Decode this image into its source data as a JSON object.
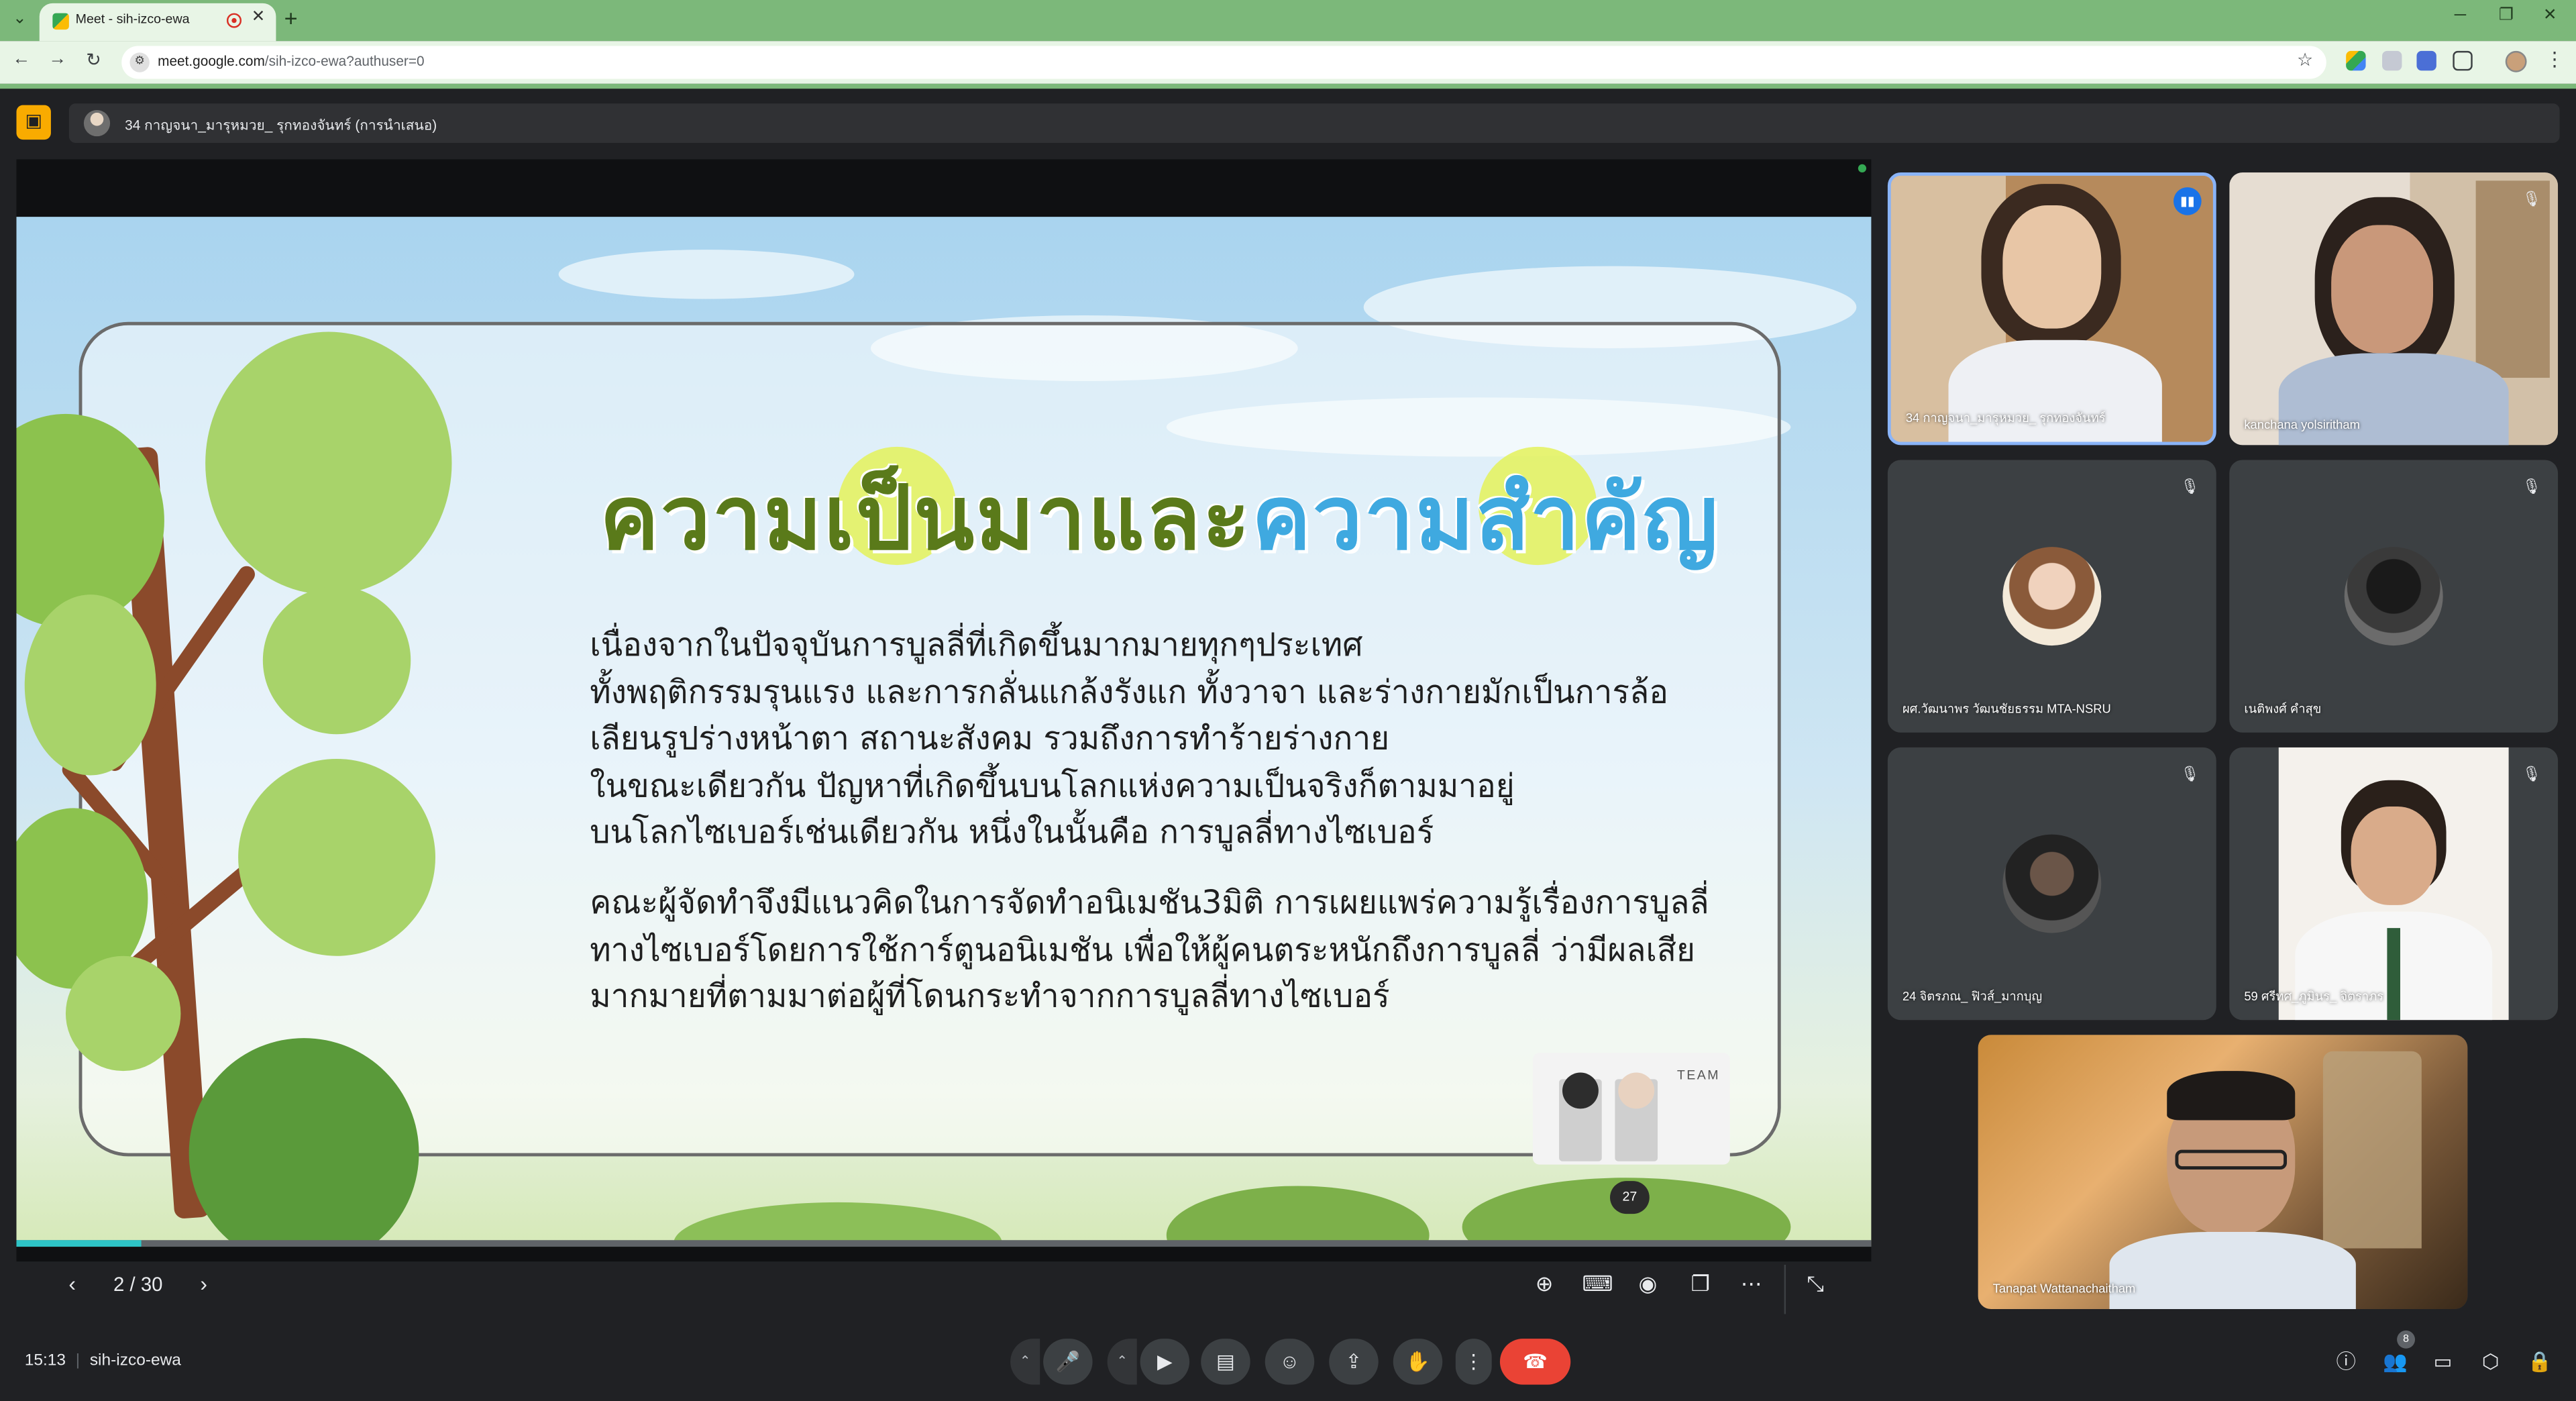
{
  "browser": {
    "tab_title": "Meet - sih-izco-ewa",
    "url_host": "meet.google.com",
    "url_path": "/sih-izco-ewa?authuser=0"
  },
  "meet": {
    "presenter_label": "34 กาญจนา_มารุหมวย_ รุกทองจันทร์ (การนำเสนอ)",
    "slide": {
      "title_part1": "ความเป็นมาและ",
      "title_part2": "ความสำคัญ",
      "paragraph1": [
        "เนื่องจากในปัจจุบันการบูลลี่ที่เกิดขึ้นมากมายทุกๆประเทศ",
        "ทั้งพฤติกรรมรุนแรง และการกลั่นแกล้งรังแก ทั้งวาจา และร่างกายมักเป็นการล้อ",
        "เลียนรูปร่างหน้าตา สถานะสังคม รวมถึงการทำร้ายร่างกาย",
        "ในขณะเดียวกัน ปัญหาที่เกิดขึ้นบนโลกแห่งความเป็นจริงก็ตามมาอยู่",
        "บนโลกไซเบอร์เช่นเดียวกัน หนึ่งในนั้นคือ การบูลลี่ทางไซเบอร์"
      ],
      "paragraph2": [
        "คณะผู้จัดทำจึงมีแนวคิดในการจัดทำอนิเมชัน3มิติ การเผยแพร่ความรู้เรื่องการบูลลี่",
        "ทางไซเบอร์โดยการใช้การ์ตูนอนิเมชัน เพื่อให้ผู้คนตระหนักถึงการบูลลี่ ว่ามีผลเสีย",
        "มากมายที่ตามมาต่อผู้ที่โดนกระทำจากการบูลลี่ทางไซเบอร์"
      ],
      "team_label": "TEAM",
      "bubble_number": "27",
      "progress_fraction": 0.067
    },
    "slide_nav": {
      "counter": "2 / 30"
    },
    "participants": [
      {
        "name": "34 กาญจนา_มารุหมวย_ รุกทองจันทร์"
      },
      {
        "name": "kanchana yolsiritham"
      },
      {
        "name": "ผศ.วัฒนาพร วัฒนชัยธรรม MTA-NSRU"
      },
      {
        "name": "เนติพงศ์ คำสุข"
      },
      {
        "name": "24 จิตรภณ_ ฟิวส์_มากบุญ"
      },
      {
        "name": "59 ศรีทศ_ภูมินร_ จิตราภร"
      },
      {
        "name": "Tanapat Wattanachaitham"
      }
    ],
    "bottom": {
      "time": "15:13",
      "meeting_code": "sih-izco-ewa",
      "people_count": "8"
    }
  },
  "colors": {
    "accent_green": "#7cb87a",
    "end_call": "#ea4335",
    "title_green": "#5a7a1a",
    "title_blue": "#3fa9e0"
  }
}
